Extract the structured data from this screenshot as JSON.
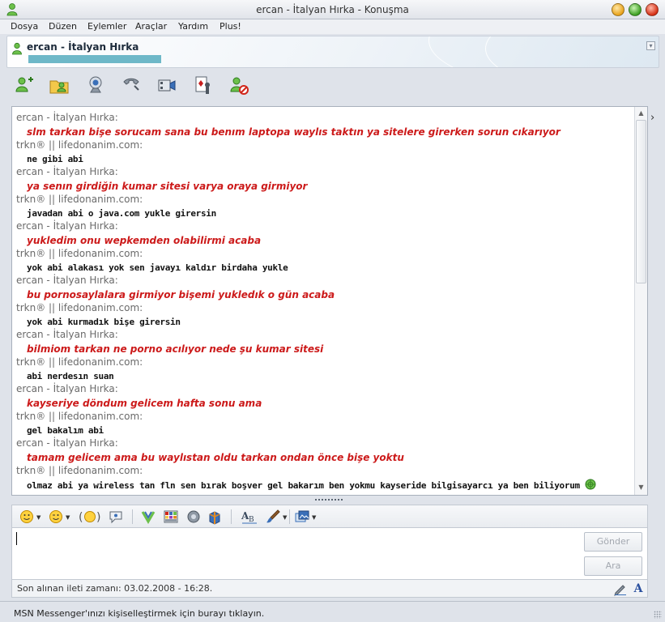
{
  "window": {
    "title": "ercan - İtalyan Hırka - Konuşma"
  },
  "menu": {
    "items": [
      "Dosya",
      "Düzen",
      "Eylemler",
      "Araçlar",
      "Yardım",
      "Plus!"
    ]
  },
  "header": {
    "contact_name": "ercan - İtalyan Hırka",
    "psm_color": "#6eb8c8"
  },
  "toolbar": {
    "icons": [
      "invite-contact-icon",
      "send-files-icon",
      "webcam-icon",
      "voice-call-icon",
      "video-icon",
      "games-icon",
      "block-contact-icon"
    ]
  },
  "chat": {
    "messages": [
      {
        "sender": "ercan - İtalyan Hırka:",
        "text": "slm tarkan bişe sorucam sana bu benım laptopa waylıs taktın ya sitelere girerken sorun cıkarıyor",
        "style": "red"
      },
      {
        "sender": "trkn® || lifedonanim.com:",
        "text": "ne gibi abi",
        "style": "black"
      },
      {
        "sender": "ercan - İtalyan Hırka:",
        "text": "ya senın girdiğin kumar sitesi varya oraya girmiyor",
        "style": "red"
      },
      {
        "sender": "trkn® || lifedonanim.com:",
        "text": "javadan abi o java.com yukle girersin",
        "style": "black"
      },
      {
        "sender": "ercan - İtalyan Hırka:",
        "text": "yukledim onu wepkemden olabilirmi acaba",
        "style": "red"
      },
      {
        "sender": "trkn® || lifedonanim.com:",
        "text": "yok abi alakası yok sen javayı kaldır birdaha yukle",
        "style": "black"
      },
      {
        "sender": "ercan - İtalyan Hırka:",
        "text": "bu pornosaylalara girmiyor bişemi yukledık o gün acaba",
        "style": "red"
      },
      {
        "sender": "trkn® || lifedonanim.com:",
        "text": "yok abi kurmadık bişe girersin",
        "style": "black"
      },
      {
        "sender": "ercan - İtalyan Hırka:",
        "text": "bilmiom tarkan ne porno acılıyor nede şu kumar sitesi",
        "style": "red"
      },
      {
        "sender": "trkn® || lifedonanim.com:",
        "text": "abi nerdesın suan",
        "style": "black"
      },
      {
        "sender": "ercan - İtalyan Hırka:",
        "text": "kayseriye döndum gelicem hafta sonu ama",
        "style": "red"
      },
      {
        "sender": "trkn® || lifedonanim.com:",
        "text": "gel bakalım abi",
        "style": "black"
      },
      {
        "sender": "ercan - İtalyan Hırka:",
        "text": "tamam gelicem ama bu waylıstan oldu tarkan ondan önce bişe yoktu",
        "style": "red"
      },
      {
        "sender": "trkn® || lifedonanim.com:",
        "text": "olmaz abi ya wireless tan fln sen bırak boşver gel bakarım ben yokmu kayseride bilgisayarcı ya ben biliyorum",
        "style": "black",
        "emoticon": "globe-smiley-icon"
      }
    ]
  },
  "format_toolbar": {
    "icons": [
      "emoticon-icon",
      "wink-icon",
      "nudge-face-icon",
      "voice-clip-icon",
      "backgrounds-icon",
      "color-grid-icon",
      "sound-icon",
      "gift-box-icon",
      "font-icon",
      "paint-icon",
      "picture-icon"
    ]
  },
  "input": {
    "send_label": "Gönder",
    "find_label": "Ara"
  },
  "status": {
    "last_message": "Son alınan ileti zamanı: 03.02.2008 - 16:28.",
    "font_button": "A"
  },
  "banner": {
    "text": "MSN Messenger'ınızı kişiselleştirmek için burayı tıklayın."
  }
}
